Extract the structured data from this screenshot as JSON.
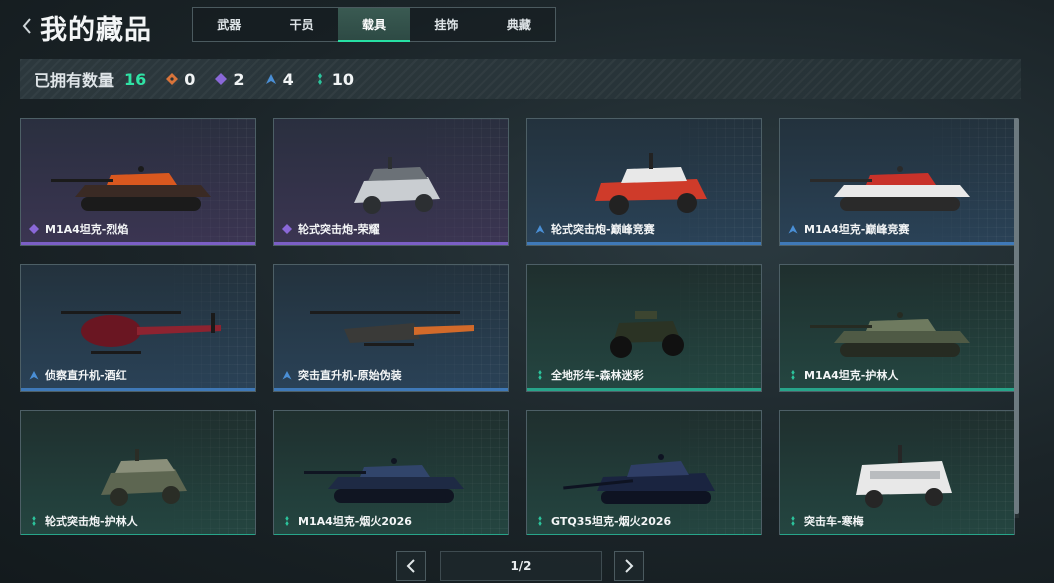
{
  "header": {
    "title": "我的藏品",
    "back_icon": "chevron-left-icon"
  },
  "tabs": [
    {
      "label": "武器",
      "active": false
    },
    {
      "label": "干员",
      "active": false
    },
    {
      "label": "载具",
      "active": true
    },
    {
      "label": "挂饰",
      "active": false
    },
    {
      "label": "典藏",
      "active": false
    }
  ],
  "stats": {
    "label": "已拥有数量",
    "total": "16",
    "rarities": [
      {
        "icon": "orange-diamond-icon",
        "color": "#d9743a",
        "count": "0"
      },
      {
        "icon": "purple-diamond-icon",
        "color": "#8a68d8",
        "count": "2"
      },
      {
        "icon": "blue-diamond-icon",
        "color": "#4a8fd6",
        "count": "4"
      },
      {
        "icon": "green-diamond-icon",
        "color": "#2cc39c",
        "count": "10"
      }
    ]
  },
  "colors": {
    "accent": "#27e0a4",
    "purple": "#7b5fc6",
    "blue": "#3f79b8",
    "green": "#27a58a"
  },
  "items": [
    {
      "name": "M1A4坦克-烈焰",
      "rarity": "purple",
      "vehicle": "tank",
      "icon": "purple-diamond-icon"
    },
    {
      "name": "轮式突击炮-荣耀",
      "rarity": "purple",
      "vehicle": "armored-car",
      "icon": "purple-diamond-icon"
    },
    {
      "name": "轮式突击炮-巅峰竞赛",
      "rarity": "blue",
      "vehicle": "buggy",
      "icon": "blue-diamond-icon"
    },
    {
      "name": "M1A4坦克-巅峰竞赛",
      "rarity": "blue",
      "vehicle": "tank",
      "icon": "blue-diamond-icon"
    },
    {
      "name": "侦察直升机-酒红",
      "rarity": "blue",
      "vehicle": "scout-helicopter",
      "icon": "blue-diamond-icon"
    },
    {
      "name": "突击直升机-原始伪装",
      "rarity": "blue",
      "vehicle": "attack-helicopter",
      "icon": "blue-diamond-icon"
    },
    {
      "name": "全地形车-森林迷彩",
      "rarity": "green",
      "vehicle": "atv",
      "icon": "green-diamond-icon"
    },
    {
      "name": "M1A4坦克-护林人",
      "rarity": "green",
      "vehicle": "tank",
      "icon": "green-diamond-icon"
    },
    {
      "name": "轮式突击炮-护林人",
      "rarity": "green",
      "vehicle": "armored-car",
      "icon": "green-diamond-icon"
    },
    {
      "name": "M1A4坦克-烟火2026",
      "rarity": "green",
      "vehicle": "tank",
      "icon": "green-diamond-icon"
    },
    {
      "name": "GTQ35坦克-烟火2026",
      "rarity": "green",
      "vehicle": "light-tank",
      "icon": "green-diamond-icon"
    },
    {
      "name": "突击车-寒梅",
      "rarity": "green",
      "vehicle": "apc",
      "icon": "green-diamond-icon"
    }
  ],
  "pagination": {
    "text": "1/2",
    "prev_icon": "chevron-left-icon",
    "next_icon": "chevron-right-icon"
  }
}
